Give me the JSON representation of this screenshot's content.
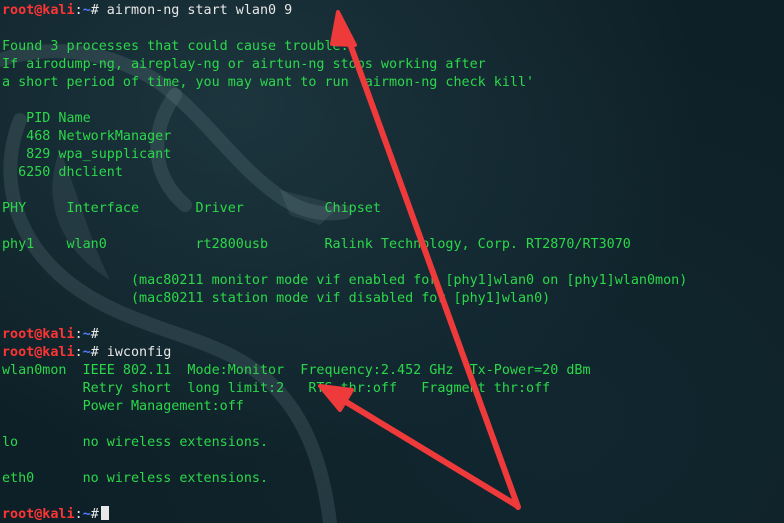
{
  "prompt": {
    "user_host": "root@kali",
    "sep": ":",
    "path": "~",
    "symbol": "#"
  },
  "lines": [
    {
      "kind": "prompt",
      "cmd": " airmon-ng start wlan0 9"
    },
    {
      "kind": "text",
      "text": ""
    },
    {
      "kind": "text",
      "text": "Found 3 processes that could cause trouble."
    },
    {
      "kind": "text",
      "text": "If airodump-ng, aireplay-ng or airtun-ng stops working after"
    },
    {
      "kind": "text",
      "text": "a short period of time, you may want to run 'airmon-ng check kill'"
    },
    {
      "kind": "text",
      "text": ""
    },
    {
      "kind": "text",
      "text": "   PID Name"
    },
    {
      "kind": "text",
      "text": "   468 NetworkManager"
    },
    {
      "kind": "text",
      "text": "   829 wpa_supplicant"
    },
    {
      "kind": "text",
      "text": "  6250 dhclient"
    },
    {
      "kind": "text",
      "text": ""
    },
    {
      "kind": "text",
      "text": "PHY     Interface       Driver          Chipset"
    },
    {
      "kind": "text",
      "text": ""
    },
    {
      "kind": "text",
      "text": "phy1    wlan0           rt2800usb       Ralink Technology, Corp. RT2870/RT3070"
    },
    {
      "kind": "text",
      "text": ""
    },
    {
      "kind": "text",
      "text": "                (mac80211 monitor mode vif enabled for [phy1]wlan0 on [phy1]wlan0mon)"
    },
    {
      "kind": "text",
      "text": "                (mac80211 station mode vif disabled for [phy1]wlan0)"
    },
    {
      "kind": "text",
      "text": ""
    },
    {
      "kind": "prompt",
      "cmd": ""
    },
    {
      "kind": "prompt",
      "cmd": " iwconfig"
    },
    {
      "kind": "text",
      "text": "wlan0mon  IEEE 802.11  Mode:Monitor  Frequency:2.452 GHz  Tx-Power=20 dBm   "
    },
    {
      "kind": "text",
      "text": "          Retry short  long limit:2   RTS thr:off   Fragment thr:off"
    },
    {
      "kind": "text",
      "text": "          Power Management:off"
    },
    {
      "kind": "text",
      "text": ""
    },
    {
      "kind": "text",
      "text": "lo        no wireless extensions."
    },
    {
      "kind": "text",
      "text": ""
    },
    {
      "kind": "text",
      "text": "eth0      no wireless extensions."
    },
    {
      "kind": "text",
      "text": ""
    },
    {
      "kind": "prompt",
      "cmd": "",
      "cursor": true
    }
  ],
  "colors": {
    "background": "#0e2027",
    "output_text": "#2bd84a",
    "user_host": "#ff3535",
    "path": "#4d7cff",
    "command": "#e8e8e8",
    "annotation_arrow": "#ee3a3a"
  },
  "annotations": [
    {
      "icon": "arrow-icon",
      "points_to": "airmon-ng start wlan0 9"
    },
    {
      "icon": "arrow-icon",
      "points_to": "Mode:Monitor"
    }
  ]
}
